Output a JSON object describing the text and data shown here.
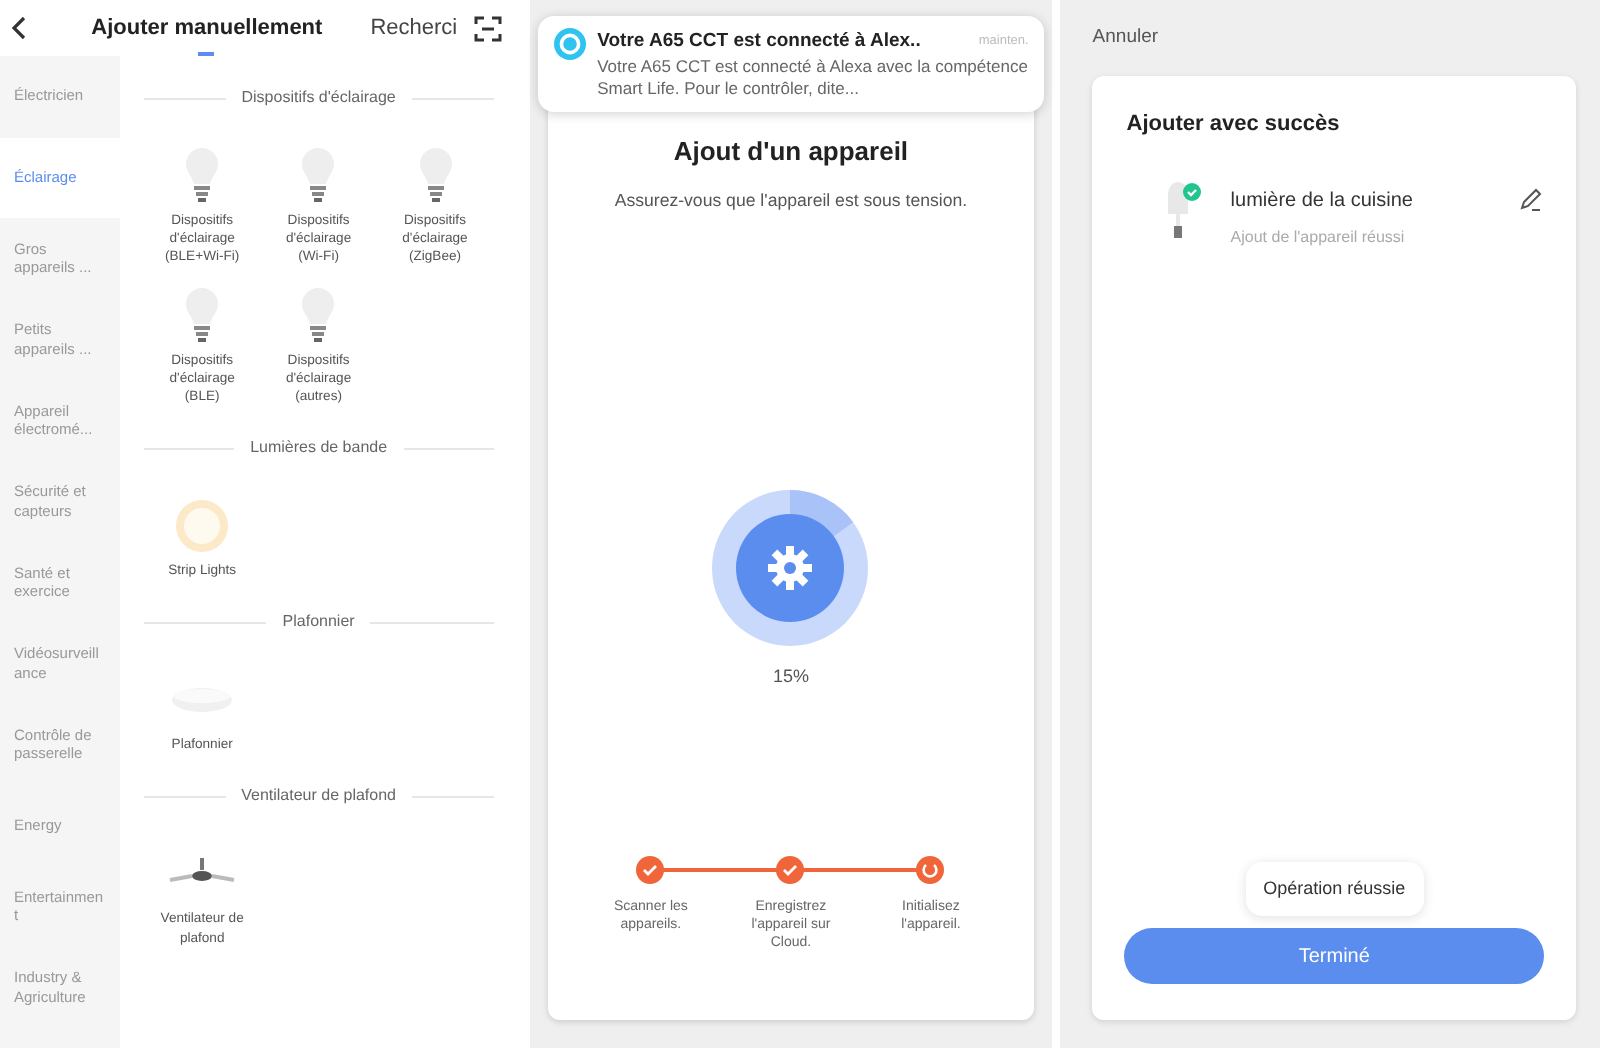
{
  "add_manually": {
    "tabs": [
      {
        "label": "Ajouter manuellement",
        "selected": true
      },
      {
        "label": "Recherci",
        "selected": false
      }
    ],
    "sidebar": {
      "items": [
        {
          "label": "Électricien",
          "selected": false
        },
        {
          "label": "Éclairage",
          "selected": true
        },
        {
          "label": "Gros appareils ...",
          "selected": false
        },
        {
          "label": "Petits appareils ...",
          "selected": false
        },
        {
          "label": "Appareil électromé...",
          "selected": false
        },
        {
          "label": "Sécurité et capteurs",
          "selected": false
        },
        {
          "label": "Santé et exercice",
          "selected": false
        },
        {
          "label": "Vidéosurveillance",
          "selected": false
        },
        {
          "label": "Contrôle de passerelle",
          "selected": false
        },
        {
          "label": "Energy",
          "selected": false
        },
        {
          "label": "Entertainment",
          "selected": false
        },
        {
          "label": "Industry & Agriculture",
          "selected": false
        }
      ]
    },
    "sections": [
      {
        "title": "Dispositifs d'éclairage",
        "devices": [
          {
            "label": "Dispositifs d'éclairage (BLE+Wi-Fi)",
            "kind": "bulb"
          },
          {
            "label": "Dispositifs d'éclairage (Wi-Fi)",
            "kind": "bulb"
          },
          {
            "label": "Dispositifs d'éclairage (ZigBee)",
            "kind": "bulb"
          },
          {
            "label": "Dispositifs d'éclairage (BLE)",
            "kind": "bulb"
          },
          {
            "label": "Dispositifs d'éclairage (autres)",
            "kind": "bulb"
          }
        ]
      },
      {
        "title": "Lumières de bande",
        "devices": [
          {
            "label": "Strip Lights",
            "kind": "strip"
          }
        ]
      },
      {
        "title": "Plafonnier",
        "devices": [
          {
            "label": "Plafonnier",
            "kind": "ceiling"
          }
        ]
      },
      {
        "title": "Ventilateur de plafond",
        "devices": [
          {
            "label": "Ventilateur de plafond",
            "kind": "fan"
          }
        ]
      }
    ]
  },
  "adding": {
    "notification": {
      "title": "Votre A65 CCT est connecté à Alex..",
      "time": "mainten.",
      "body": "Votre A65 CCT est connecté à Alexa avec la compétence Smart Life. Pour le contrôler, dite..."
    },
    "title": "Ajout d'un appareil",
    "subtitle": "Assurez-vous que l'appareil est sous tension.",
    "progress": {
      "reading": "15%"
    },
    "steps": [
      {
        "label": "Scanner les appareils.",
        "done": true
      },
      {
        "label": "Enregistrez l'appareil sur Cloud.",
        "done": true
      },
      {
        "label": "Initialisez l'appareil.",
        "done": false
      }
    ]
  },
  "success": {
    "cancel": "Annuler",
    "title": "Ajouter avec succès",
    "device": {
      "name": "lumière de la cuisine",
      "status": "Ajout de l'appareil réussi"
    },
    "toast": "Opération réussie",
    "button": "Terminé"
  }
}
